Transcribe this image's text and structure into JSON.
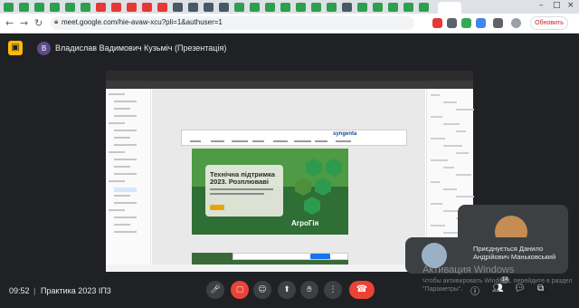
{
  "browser": {
    "url": "meet.google.com/hie-avaw-xcu?pli=1&authuser=1",
    "update_label": "Обновить",
    "colors": {
      "tab_green": "#2e9e4f",
      "tab_red": "#e53935",
      "tab_dark": "#455a64"
    }
  },
  "meet": {
    "presenter": "Владислав Вадимович Кузьміч (Презентація)",
    "presenter_initial": "В",
    "time": "09:52",
    "separator": "|",
    "meeting_name": "Практика 2023 ІП3",
    "participant_count": "14",
    "join_notice": "Приєднується Данило Андрійович Маньковський"
  },
  "shared_screen": {
    "logo": "syngenta",
    "banner_title": "Технічна підтримка 2023. Розплюваві",
    "banner_brand": "АгроГія"
  },
  "watermark": {
    "title": "Активация Windows",
    "subtitle": "Чтобы активировать Windows, перейдите в раздел \"Параметры\"."
  },
  "icons": {
    "back": "arrow-left-icon",
    "forward": "arrow-right-icon",
    "reload": "reload-icon",
    "mic": "mic-icon",
    "camera": "camera-off-icon",
    "emoji": "emoji-icon",
    "present": "present-screen-icon",
    "hand": "raise-hand-icon",
    "more": "more-vert-icon",
    "hangup": "hangup-icon",
    "info": "info-icon",
    "people": "people-icon",
    "chat": "chat-icon",
    "activities": "activities-icon"
  }
}
